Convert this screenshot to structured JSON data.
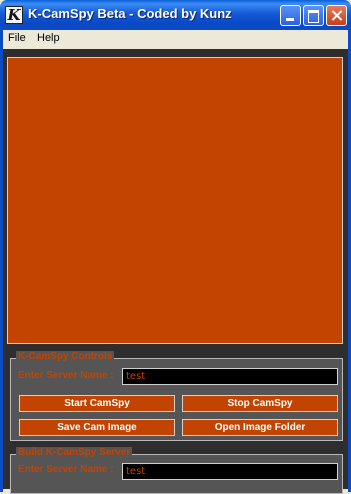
{
  "window": {
    "title": "K-CamSpy Beta - Coded by Kunz",
    "icon_letter": "K"
  },
  "menu": {
    "items": [
      {
        "label": "File"
      },
      {
        "label": "Help"
      }
    ]
  },
  "controls": {
    "legend": "K-CamSpy Controls",
    "server_label": "Enter Server Name :",
    "server_value": "test",
    "buttons": {
      "start": "Start CamSpy",
      "stop": "Stop CamSpy",
      "save": "Save Cam Image",
      "open": "Open Image Folder"
    }
  },
  "build": {
    "legend": "Build K-CamSpy Server",
    "server_label": "Enter Server Name :",
    "server_value": "test"
  },
  "colors": {
    "accent": "#c34400",
    "panel": "#555555",
    "background": "#2e2e2e"
  }
}
